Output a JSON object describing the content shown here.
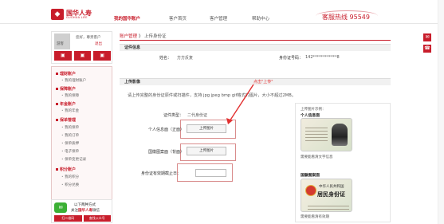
{
  "header": {
    "logo_cn": "国华人寿",
    "logo_en": "GUOHUA LIFE",
    "nav": [
      "我的国华账户",
      "客户首页",
      "客户管理",
      "帮助中心"
    ],
    "hotline": "客服热线 95549"
  },
  "sidebar": {
    "greeting": "您好，尊贵客户",
    "username": "游客",
    "logout": "退出",
    "quick_icons": [
      "▣",
      "▣",
      "▣"
    ],
    "menu": [
      {
        "head": "理财账户",
        "items": [
          "我的理财账户"
        ]
      },
      {
        "head": "保障账户",
        "items": [
          "我的保障"
        ]
      },
      {
        "head": "年金账户",
        "items": [
          "我的年金"
        ]
      },
      {
        "head": "保单管理",
        "items": [
          "我的保单",
          "我的订单",
          "保单质押",
          "电子保单",
          "保单变更记录"
        ]
      },
      {
        "head": "积分账户",
        "items": [
          "我的积分",
          "积分兑换"
        ]
      }
    ],
    "wechat_line1": "以下两种方式",
    "wechat_line2_pre": "关注",
    "wechat_line2_brand": "国华人寿",
    "wechat_line2_post": "微信",
    "wechat_btn1": "扫二维码",
    "wechat_btn2": "查找公众号"
  },
  "main": {
    "breadcrumb_link": "账户管理",
    "breadcrumb_sep": "》",
    "breadcrumb_current": "上传身份证",
    "section1_title": "证件信息",
    "name_label": "姓名：",
    "name_value": "方方反复",
    "id_label": "身份证号码：",
    "id_value": "142************8",
    "section2_title": "上传影像",
    "upload_note": "请上传完整的身份证原件或扫描件，支持 jpg jpeg bmp gif格式的图片，大小不超过2MB。",
    "cert_type_label": "证件类型：",
    "cert_type_value": "二代身份证",
    "front_label": "个人信息面（正面）",
    "back_label": "国徽图案面（背面）",
    "expiry_label": "身份证有效期截止日：",
    "upload_button": "上传图片",
    "callout": "点击\"上传\""
  },
  "examples": {
    "title": "上传图片示例：",
    "front_title": "个人信息面",
    "front_caption": "需要能看清文字信息",
    "back_title": "国徽图案面",
    "back_caption": "需要能看清有效期",
    "card_back_line1": "中华人民共和国",
    "card_back_line2": "居民身份证"
  },
  "colors": {
    "brand": "#c81d2b",
    "callout": "#e23030"
  }
}
